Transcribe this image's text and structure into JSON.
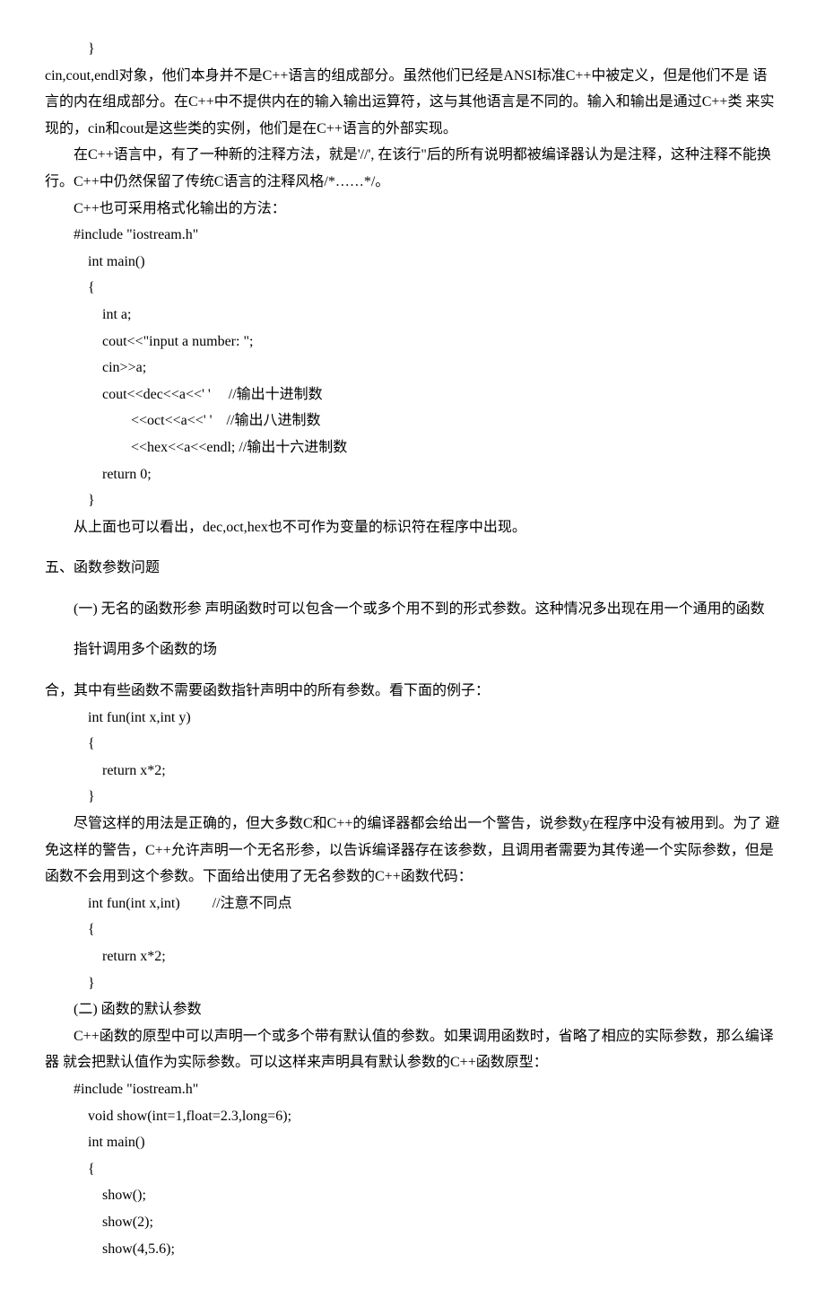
{
  "top": {
    "brace": "}",
    "p1": "cin,cout,endl对象，他们本身并不是C++语言的组成部分。虽然他们已经是ANSI标准C++中被定义，但是他们不是 语言的内在组成部分。在C++中不提供内在的输入输出运算符，这与其他语言是不同的。输入和输出是通过C++类 来实现的，cin和cout是这些类的实例，他们是在C++语言的外部实现。",
    "p2": "在C++语言中，有了一种新的注释方法，就是'//', 在该行\"后的所有说明都被编译器认为是注释，这种注释不能换 行。C++中仍然保留了传统C语言的注释风格/*……*/。",
    "p3": "C++也可采用格式化输出的方法：",
    "code": {
      "l1": "#include \"iostream.h\"",
      "l2": "int main()",
      "l3": "{",
      "l4": "int a;",
      "l5": "cout<<\"input a number: \";",
      "l6": "cin>>a;",
      "l7": "cout<<dec<<a<<' '     //输出十进制数",
      "l8": "<<oct<<a<<' '    //输出八进制数",
      "l9": "<<hex<<a<<endl; //输出十六进制数",
      "l10": "return 0;",
      "l11": "}"
    },
    "p4": "从上面也可以看出，dec,oct,hex也不可作为变量的标识符在程序中出现。"
  },
  "sec5": {
    "title": "五、函数参数问题",
    "item1_line1": "(一)  无名的函数形参  声明函数时可以包含一个或多个用不到的形式参数。这种情况多出现在用一个通用的函数",
    "item1_line2": "指针调用多个函数的场",
    "p1": "合，其中有些函数不需要函数指针声明中的所有参数。看下面的例子：",
    "code1": {
      "l1": "int fun(int x,int y)",
      "l2": "{",
      "l3": "return x*2;",
      "l4": "}"
    },
    "p2": "尽管这样的用法是正确的，但大多数C和C++的编译器都会给出一个警告，说参数y在程序中没有被用到。为了 避免这样的警告，C++允许声明一个无名形参，以告诉编译器存在该参数，且调用者需要为其传递一个实际参数，但是函数不会用到这个参数。下面给出使用了无名参数的C++函数代码：",
    "code2": {
      "l1": "int fun(int x,int)         //注意不同点",
      "l2": "{",
      "l3": "return x*2;",
      "l4": "}"
    },
    "item2": "(二)  函数的默认参数",
    "p3": "C++函数的原型中可以声明一个或多个带有默认值的参数。如果调用函数时，省略了相应的实际参数，那么编译器 就会把默认值作为实际参数。可以这样来声明具有默认参数的C++函数原型：",
    "code3": {
      "l1": "#include \"iostream.h\"",
      "l2": "void show(int=1,float=2.3,long=6);",
      "l3": "int main()",
      "l4": "{",
      "l5": "show();",
      "l6": "show(2);",
      "l7": "show(4,5.6);"
    }
  }
}
